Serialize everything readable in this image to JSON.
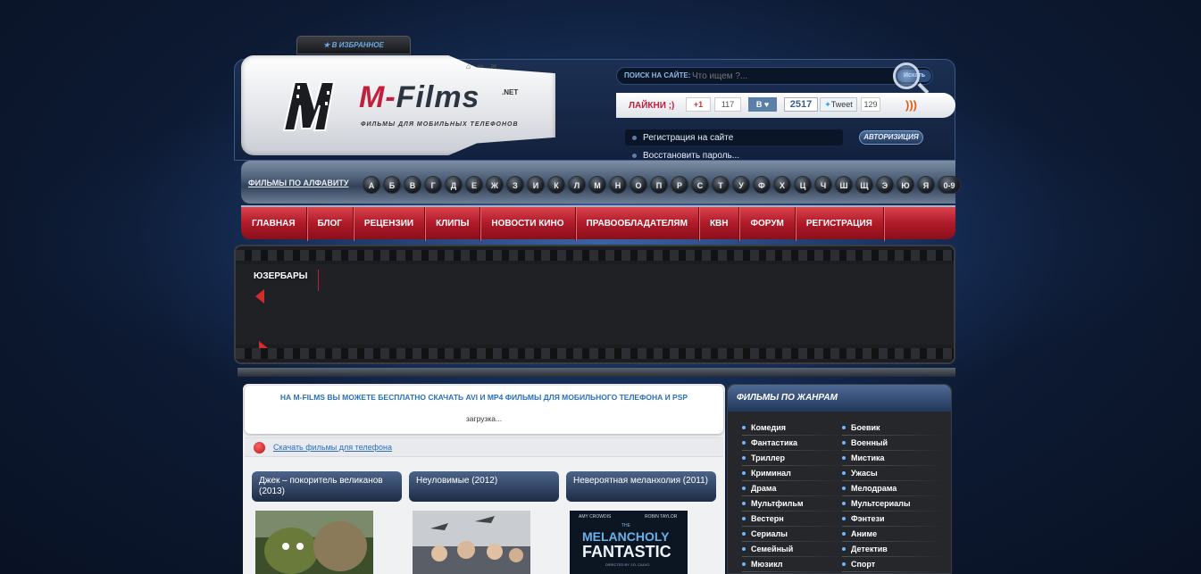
{
  "favorites": {
    "label": "В ИЗБРАННОЕ"
  },
  "logo": {
    "brand_main": "M-",
    "brand_films": "Films",
    "tld": ".NET",
    "tagline": "ФИЛЬМЫ ДЛЯ МОБИЛЬНЫХ ТЕЛЕФОНОВ"
  },
  "search": {
    "label": "ПОИСК НА САЙТЕ:",
    "placeholder": "Что ищем ?...",
    "button": "Искать"
  },
  "social": {
    "likes_label": "ЛАЙКНИ ;)",
    "gplus_label": "+1",
    "gplus_count": "117",
    "vk_label": "В ♥",
    "vk_count": "2517",
    "tweet_label": "Tweet",
    "tweet_count": "129",
    "rss_icon": "rss-icon"
  },
  "auth": {
    "register_link": "Регистрация на сайте",
    "restore_link": "Восстановить пароль...",
    "login_button": "АВТОРИЗИЦИЯ"
  },
  "alphabet": {
    "title": "ФИЛЬМЫ ПО АЛФАВИТУ",
    "letters": [
      "А",
      "Б",
      "В",
      "Г",
      "Д",
      "Е",
      "Ж",
      "З",
      "И",
      "К",
      "Л",
      "М",
      "Н",
      "О",
      "П",
      "Р",
      "С",
      "Т",
      "У",
      "Ф",
      "Х",
      "Ц",
      "Ч",
      "Ш",
      "Щ",
      "Э",
      "Ю",
      "Я",
      "0-9"
    ]
  },
  "menu": [
    "ГЛАВНАЯ",
    "БЛОГ",
    "РЕЦЕНЗИИ",
    "КЛИПЫ",
    "НОВОСТИ КИНО",
    "ПРАВООБЛАДАТЕЛЯМ",
    "КВН",
    "ФОРУМ",
    "РЕГИСТРАЦИЯ"
  ],
  "userbars": {
    "title": "ЮЗЕРБАРЫ"
  },
  "main": {
    "notice": "НА M-FILMS ВЫ МОЖЕТЕ БЕСПЛАТНО СКАЧАТЬ AVI И MP4 ФИЛЬМЫ ДЛЯ МОБИЛЬНОГО ТЕЛЕФОНА И PSP",
    "loading": "загрузка...",
    "download_link": "Скачать фильмы для телефона",
    "cards": [
      {
        "title": "Джек – покоритель великанов (2013)"
      },
      {
        "title": "Неуловимые (2012)"
      },
      {
        "title": "Невероятная меланхолия (2011)"
      }
    ],
    "poster3": {
      "actor1": "AMY CROWDIS",
      "actor2": "ROBIN TAYLOR",
      "the": "THE",
      "line1": "MELANCHOLY",
      "line2": "FANTASTIC",
      "director": "DIRECTED BY J.D. CALVO"
    }
  },
  "sidebar": {
    "title": "ФИЛЬМЫ ПО ЖАНРАМ",
    "col1": [
      "Комедия",
      "Фантастика",
      "Триллер",
      "Криминал",
      "Драма",
      "Мультфильм",
      "Вестерн",
      "Сериалы",
      "Семейный",
      "Мюзикл"
    ],
    "col2": [
      "Боевик",
      "Военный",
      "Мистика",
      "Ужасы",
      "Мелодрама",
      "Мультсериалы",
      "Фэнтези",
      "Аниме",
      "Детектив",
      "Спорт"
    ]
  },
  "colors": {
    "accent_red": "#c0203c",
    "link_blue": "#2a6fba",
    "bg_dark": "#0d1a33"
  }
}
